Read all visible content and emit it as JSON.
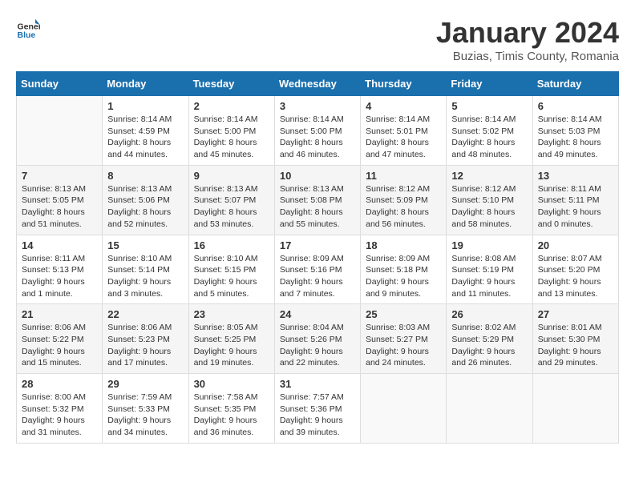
{
  "logo": {
    "text_general": "General",
    "text_blue": "Blue"
  },
  "title": "January 2024",
  "subtitle": "Buzias, Timis County, Romania",
  "days_of_week": [
    "Sunday",
    "Monday",
    "Tuesday",
    "Wednesday",
    "Thursday",
    "Friday",
    "Saturday"
  ],
  "weeks": [
    [
      {
        "day": "",
        "sunrise": "",
        "sunset": "",
        "daylight": ""
      },
      {
        "day": "1",
        "sunrise": "Sunrise: 8:14 AM",
        "sunset": "Sunset: 4:59 PM",
        "daylight": "Daylight: 8 hours and 44 minutes."
      },
      {
        "day": "2",
        "sunrise": "Sunrise: 8:14 AM",
        "sunset": "Sunset: 5:00 PM",
        "daylight": "Daylight: 8 hours and 45 minutes."
      },
      {
        "day": "3",
        "sunrise": "Sunrise: 8:14 AM",
        "sunset": "Sunset: 5:00 PM",
        "daylight": "Daylight: 8 hours and 46 minutes."
      },
      {
        "day": "4",
        "sunrise": "Sunrise: 8:14 AM",
        "sunset": "Sunset: 5:01 PM",
        "daylight": "Daylight: 8 hours and 47 minutes."
      },
      {
        "day": "5",
        "sunrise": "Sunrise: 8:14 AM",
        "sunset": "Sunset: 5:02 PM",
        "daylight": "Daylight: 8 hours and 48 minutes."
      },
      {
        "day": "6",
        "sunrise": "Sunrise: 8:14 AM",
        "sunset": "Sunset: 5:03 PM",
        "daylight": "Daylight: 8 hours and 49 minutes."
      }
    ],
    [
      {
        "day": "7",
        "sunrise": "Sunrise: 8:13 AM",
        "sunset": "Sunset: 5:05 PM",
        "daylight": "Daylight: 8 hours and 51 minutes."
      },
      {
        "day": "8",
        "sunrise": "Sunrise: 8:13 AM",
        "sunset": "Sunset: 5:06 PM",
        "daylight": "Daylight: 8 hours and 52 minutes."
      },
      {
        "day": "9",
        "sunrise": "Sunrise: 8:13 AM",
        "sunset": "Sunset: 5:07 PM",
        "daylight": "Daylight: 8 hours and 53 minutes."
      },
      {
        "day": "10",
        "sunrise": "Sunrise: 8:13 AM",
        "sunset": "Sunset: 5:08 PM",
        "daylight": "Daylight: 8 hours and 55 minutes."
      },
      {
        "day": "11",
        "sunrise": "Sunrise: 8:12 AM",
        "sunset": "Sunset: 5:09 PM",
        "daylight": "Daylight: 8 hours and 56 minutes."
      },
      {
        "day": "12",
        "sunrise": "Sunrise: 8:12 AM",
        "sunset": "Sunset: 5:10 PM",
        "daylight": "Daylight: 8 hours and 58 minutes."
      },
      {
        "day": "13",
        "sunrise": "Sunrise: 8:11 AM",
        "sunset": "Sunset: 5:11 PM",
        "daylight": "Daylight: 9 hours and 0 minutes."
      }
    ],
    [
      {
        "day": "14",
        "sunrise": "Sunrise: 8:11 AM",
        "sunset": "Sunset: 5:13 PM",
        "daylight": "Daylight: 9 hours and 1 minute."
      },
      {
        "day": "15",
        "sunrise": "Sunrise: 8:10 AM",
        "sunset": "Sunset: 5:14 PM",
        "daylight": "Daylight: 9 hours and 3 minutes."
      },
      {
        "day": "16",
        "sunrise": "Sunrise: 8:10 AM",
        "sunset": "Sunset: 5:15 PM",
        "daylight": "Daylight: 9 hours and 5 minutes."
      },
      {
        "day": "17",
        "sunrise": "Sunrise: 8:09 AM",
        "sunset": "Sunset: 5:16 PM",
        "daylight": "Daylight: 9 hours and 7 minutes."
      },
      {
        "day": "18",
        "sunrise": "Sunrise: 8:09 AM",
        "sunset": "Sunset: 5:18 PM",
        "daylight": "Daylight: 9 hours and 9 minutes."
      },
      {
        "day": "19",
        "sunrise": "Sunrise: 8:08 AM",
        "sunset": "Sunset: 5:19 PM",
        "daylight": "Daylight: 9 hours and 11 minutes."
      },
      {
        "day": "20",
        "sunrise": "Sunrise: 8:07 AM",
        "sunset": "Sunset: 5:20 PM",
        "daylight": "Daylight: 9 hours and 13 minutes."
      }
    ],
    [
      {
        "day": "21",
        "sunrise": "Sunrise: 8:06 AM",
        "sunset": "Sunset: 5:22 PM",
        "daylight": "Daylight: 9 hours and 15 minutes."
      },
      {
        "day": "22",
        "sunrise": "Sunrise: 8:06 AM",
        "sunset": "Sunset: 5:23 PM",
        "daylight": "Daylight: 9 hours and 17 minutes."
      },
      {
        "day": "23",
        "sunrise": "Sunrise: 8:05 AM",
        "sunset": "Sunset: 5:25 PM",
        "daylight": "Daylight: 9 hours and 19 minutes."
      },
      {
        "day": "24",
        "sunrise": "Sunrise: 8:04 AM",
        "sunset": "Sunset: 5:26 PM",
        "daylight": "Daylight: 9 hours and 22 minutes."
      },
      {
        "day": "25",
        "sunrise": "Sunrise: 8:03 AM",
        "sunset": "Sunset: 5:27 PM",
        "daylight": "Daylight: 9 hours and 24 minutes."
      },
      {
        "day": "26",
        "sunrise": "Sunrise: 8:02 AM",
        "sunset": "Sunset: 5:29 PM",
        "daylight": "Daylight: 9 hours and 26 minutes."
      },
      {
        "day": "27",
        "sunrise": "Sunrise: 8:01 AM",
        "sunset": "Sunset: 5:30 PM",
        "daylight": "Daylight: 9 hours and 29 minutes."
      }
    ],
    [
      {
        "day": "28",
        "sunrise": "Sunrise: 8:00 AM",
        "sunset": "Sunset: 5:32 PM",
        "daylight": "Daylight: 9 hours and 31 minutes."
      },
      {
        "day": "29",
        "sunrise": "Sunrise: 7:59 AM",
        "sunset": "Sunset: 5:33 PM",
        "daylight": "Daylight: 9 hours and 34 minutes."
      },
      {
        "day": "30",
        "sunrise": "Sunrise: 7:58 AM",
        "sunset": "Sunset: 5:35 PM",
        "daylight": "Daylight: 9 hours and 36 minutes."
      },
      {
        "day": "31",
        "sunrise": "Sunrise: 7:57 AM",
        "sunset": "Sunset: 5:36 PM",
        "daylight": "Daylight: 9 hours and 39 minutes."
      },
      {
        "day": "",
        "sunrise": "",
        "sunset": "",
        "daylight": ""
      },
      {
        "day": "",
        "sunrise": "",
        "sunset": "",
        "daylight": ""
      },
      {
        "day": "",
        "sunrise": "",
        "sunset": "",
        "daylight": ""
      }
    ]
  ]
}
